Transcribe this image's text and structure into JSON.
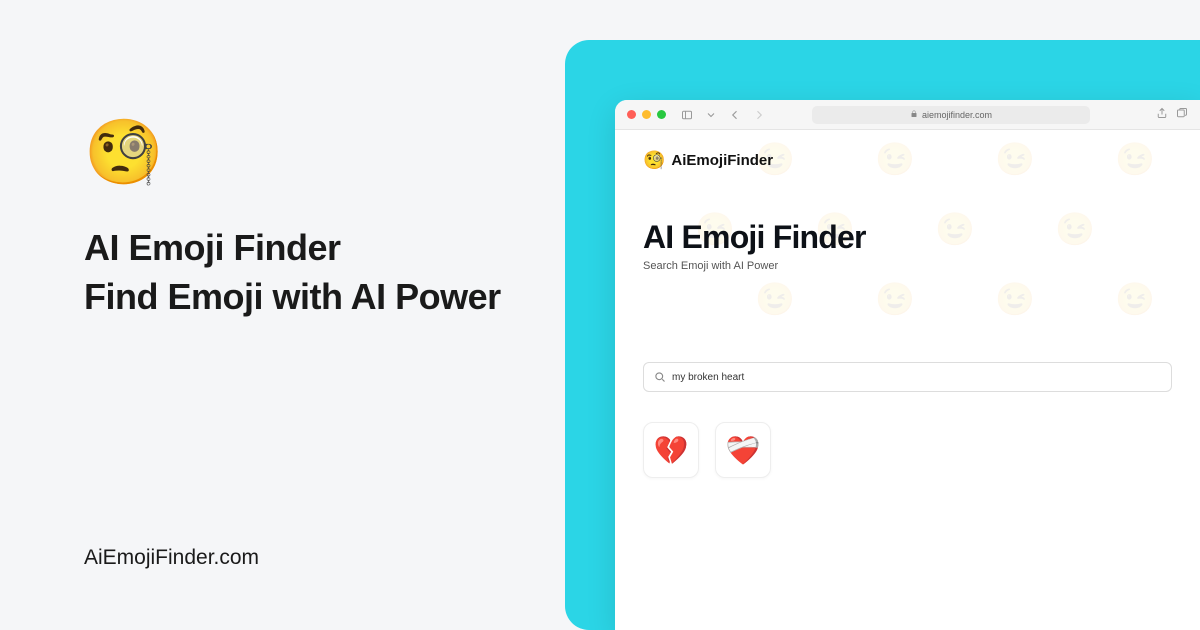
{
  "hero": {
    "emoji": "🧐",
    "title_line1": "AI Emoji Finder",
    "title_line2": "Find Emoji with AI Power",
    "domain": "AiEmojiFinder.com"
  },
  "browser": {
    "url": "aiemojifinder.com"
  },
  "app": {
    "logo_emoji": "🧐",
    "logo_text": "AiEmojiFinder",
    "hero_title": "AI Emoji Finder",
    "hero_sub": "Search Emoji with AI Power",
    "search_value": "my broken heart",
    "results": [
      "💔",
      "❤️‍🩹"
    ],
    "bg_emoji": "😉"
  }
}
